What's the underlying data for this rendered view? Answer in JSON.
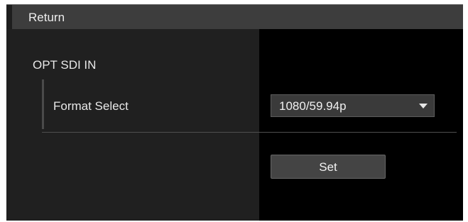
{
  "section": {
    "title": "Return"
  },
  "settings": {
    "group_label": "OPT SDI IN",
    "format_select": {
      "label": "Format Select",
      "value": "1080/59.94p"
    },
    "set_label": "Set"
  },
  "icons": {
    "dropdown": "triangle-down-icon"
  },
  "colors": {
    "background": "#000000",
    "header": "#3d3d3d",
    "label_column": "#202020",
    "control": "#3a3a3a",
    "text": "#e8e8e8"
  }
}
